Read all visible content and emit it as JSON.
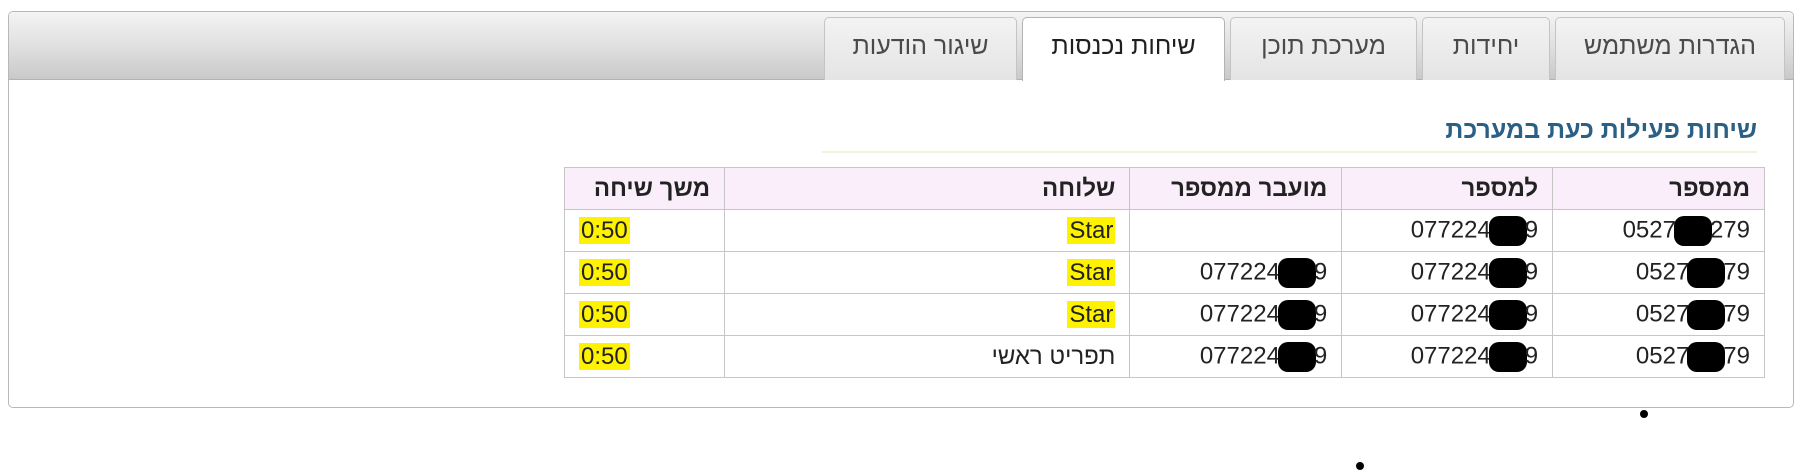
{
  "tabs": [
    {
      "label": "הגדרות משתמש",
      "active": false
    },
    {
      "label": "יחידות",
      "active": false
    },
    {
      "label": "מערכת תוכן",
      "active": false
    },
    {
      "label": "שיחות נכנסות",
      "active": true
    },
    {
      "label": "שיגור הודעות",
      "active": false
    }
  ],
  "section_title": "שיחות פעילות כעת במערכת",
  "table": {
    "headers": {
      "from": "ממספר",
      "to": "למספר",
      "transferred_from": "מועבר ממספר",
      "sender": "שלוחה",
      "duration": "משך שיחה"
    },
    "rows": [
      {
        "from_prefix": "0527",
        "from_suffix": "279",
        "to_prefix": "077224",
        "to_suffix": "9",
        "transferred_prefix": "",
        "transferred_suffix": "",
        "sender": "Star",
        "duration": "0:50"
      },
      {
        "from_prefix": "0527",
        "from_suffix": "79",
        "to_prefix": "077224",
        "to_suffix": "9",
        "transferred_prefix": "077224",
        "transferred_suffix": "9",
        "sender": "Star",
        "duration": "0:50"
      },
      {
        "from_prefix": "0527",
        "from_suffix": "79",
        "to_prefix": "077224",
        "to_suffix": "9",
        "transferred_prefix": "077224",
        "transferred_suffix": "9",
        "sender": "Star",
        "duration": "0:50"
      },
      {
        "from_prefix": "0527",
        "from_suffix": "79",
        "to_prefix": "077224",
        "to_suffix": "9",
        "transferred_prefix": "077224",
        "transferred_suffix": "9",
        "sender": "תפריט ראשי",
        "duration": "0:50"
      }
    ]
  },
  "colors": {
    "title": "#2a5f86",
    "header_bg": "#fbeefb",
    "highlight": "#fff200",
    "redaction": "#000000"
  }
}
